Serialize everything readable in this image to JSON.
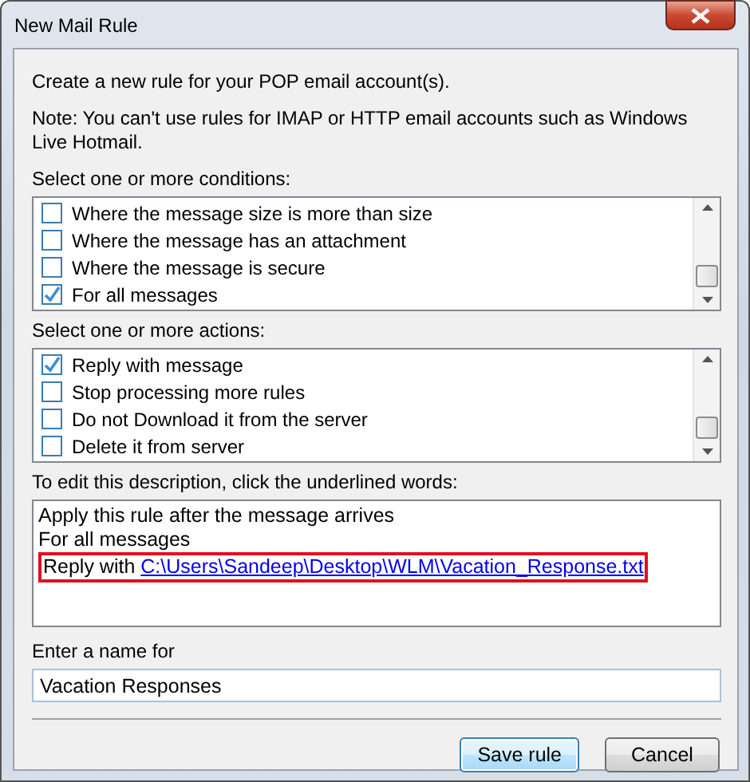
{
  "window": {
    "title": "New Mail Rule"
  },
  "intro": "Create a new rule for your POP email account(s).",
  "note": "Note: You can't use rules for IMAP or HTTP email accounts such as Windows Live Hotmail.",
  "conditions": {
    "label": "Select one or more conditions:",
    "items": [
      {
        "label": "Where the message size is more than size",
        "checked": false
      },
      {
        "label": "Where the message has an attachment",
        "checked": false
      },
      {
        "label": "Where the message is secure",
        "checked": false
      },
      {
        "label": "For all messages",
        "checked": true
      }
    ]
  },
  "actions": {
    "label": "Select one or more actions:",
    "items": [
      {
        "label": "Reply with message",
        "checked": true
      },
      {
        "label": "Stop processing more rules",
        "checked": false
      },
      {
        "label": "Do not Download it from the server",
        "checked": false
      },
      {
        "label": "Delete it from server",
        "checked": false
      }
    ]
  },
  "description": {
    "label": "To edit this description, click the underlined words:",
    "lines": [
      {
        "text": "Apply this rule after the message arrives",
        "highlighted": false
      },
      {
        "text": "For all messages",
        "highlighted": false
      },
      {
        "text": "Reply with",
        "link": "C:\\Users\\Sandeep\\Desktop\\WLM\\Vacation_Response.txt",
        "highlighted": true
      }
    ]
  },
  "name_field": {
    "label": "Enter a name for",
    "value": "Vacation Responses"
  },
  "buttons": [
    {
      "label": "Save rule",
      "default": true
    },
    {
      "label": "Cancel",
      "default": false
    }
  ]
}
